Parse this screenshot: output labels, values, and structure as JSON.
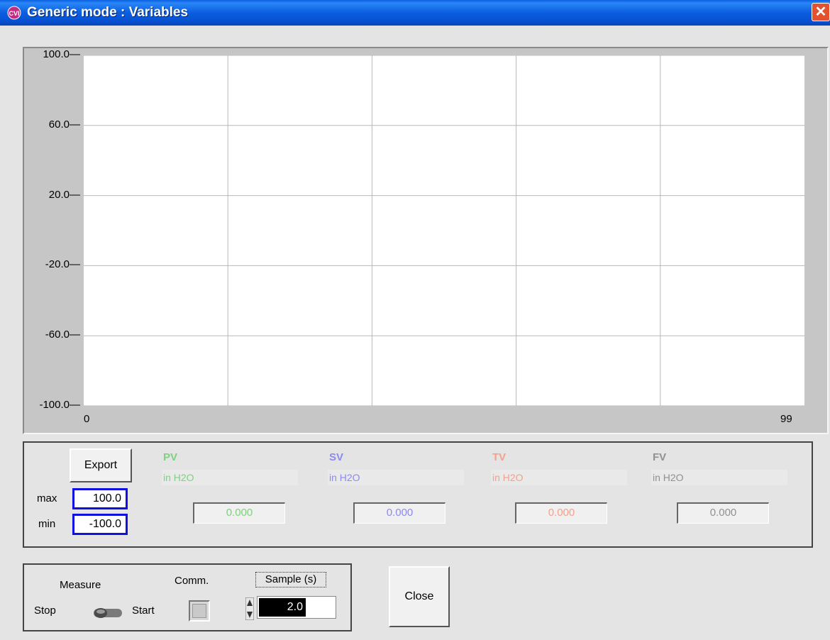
{
  "window": {
    "title": "Generic mode : Variables",
    "close_glyph": "✕",
    "icon": "cvi-app-icon"
  },
  "chart_data": {
    "type": "line",
    "title": "",
    "xlabel": "",
    "ylabel": "",
    "xlim": [
      0,
      99
    ],
    "ylim": [
      -100,
      100
    ],
    "y_tick_labels": [
      "100.0",
      "60.0",
      "20.0",
      "-20.0",
      "-60.0",
      "-100.0"
    ],
    "x_tick_labels": [
      "0",
      "99"
    ],
    "grid": true,
    "series": []
  },
  "variables_panel": {
    "export_label": "Export",
    "max_label": "max",
    "max_value": "100.0",
    "min_label": "min",
    "min_value": "-100.0",
    "variables": [
      {
        "name": "PV",
        "unit": "in H2O",
        "value": "0.000",
        "color": "#7fd07f"
      },
      {
        "name": "SV",
        "unit": "in H2O",
        "value": "0.000",
        "color": "#8a8af0"
      },
      {
        "name": "TV",
        "unit": "in H2O",
        "value": "0.000",
        "color": "#f4a08c"
      },
      {
        "name": "FV",
        "unit": "in H2O",
        "value": "0.000",
        "color": "#909090"
      }
    ]
  },
  "controls": {
    "measure_label": "Measure",
    "stop_label": "Stop",
    "start_label": "Start",
    "comm_label": "Comm.",
    "sample_label": "Sample (s)",
    "sample_value": "2.0",
    "close_label": "Close"
  }
}
